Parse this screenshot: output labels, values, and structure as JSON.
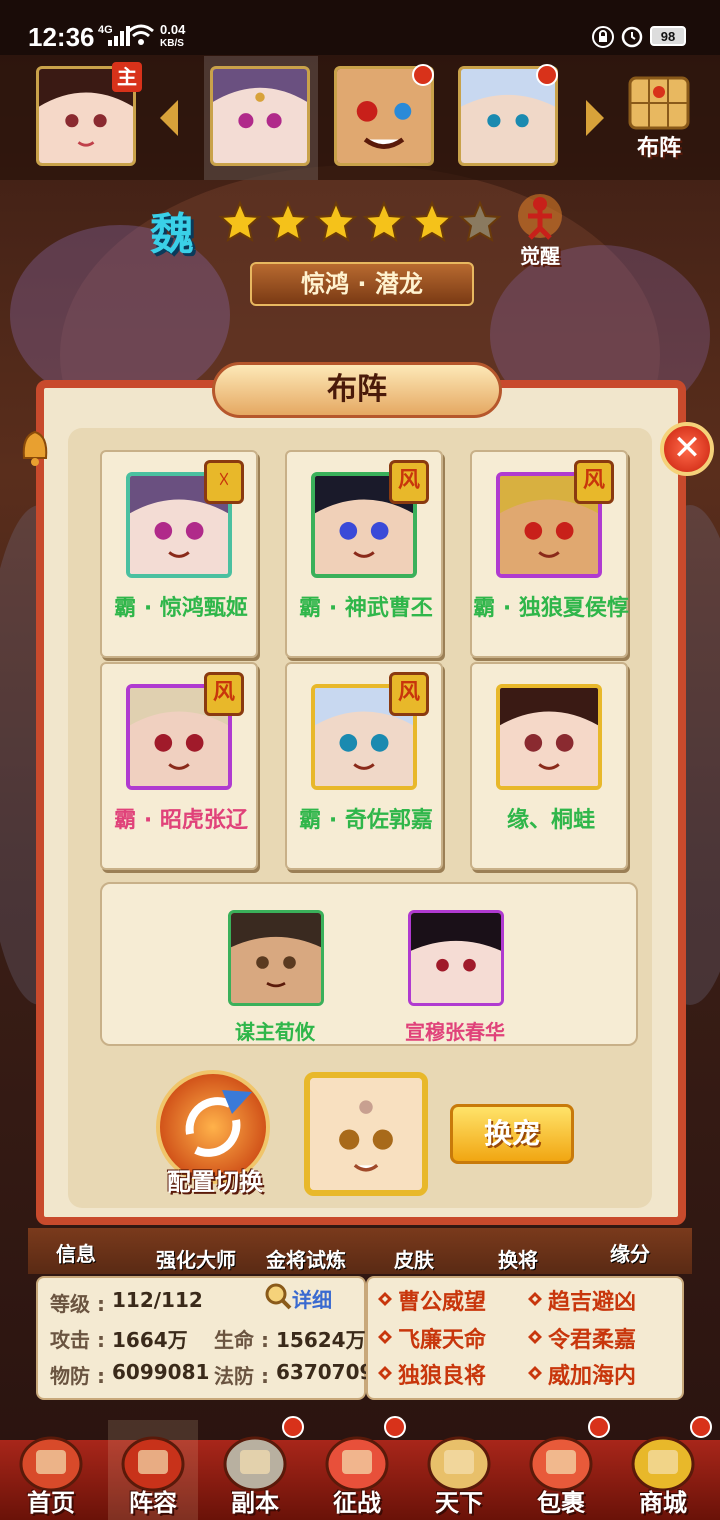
{
  "status_bar": {
    "time": "12:36",
    "network": "4G",
    "speed_value": "0.04",
    "speed_unit": "KB/S",
    "battery": "98"
  },
  "top_bar": {
    "leader_badge": "主",
    "formation_button": "布阵"
  },
  "hero_header": {
    "kingdom": "魏",
    "stars_filled": 5,
    "stars_total": 6,
    "awaken_label": "觉醒",
    "title": "惊鸿 · 潜龙"
  },
  "panel": {
    "title": "布阵",
    "close_icon": "✕",
    "heroes": [
      {
        "name": "霸 · 惊鸿甄姬",
        "badge": "☓",
        "badge_icon": "cross-icon",
        "name_color": "green"
      },
      {
        "name": "霸 · 神武曹丕",
        "badge": "风",
        "badge_icon": "wind-icon",
        "name_color": "green"
      },
      {
        "name": "霸 · 独狼夏侯惇",
        "badge": "风",
        "badge_icon": "wind-icon",
        "name_color": "green"
      },
      {
        "name": "霸 · 昭虎张辽",
        "badge": "风",
        "badge_icon": "wind-icon",
        "name_color": "pink"
      },
      {
        "name": "霸 · 奇佐郭嘉",
        "badge": "风",
        "badge_icon": "wind-icon",
        "name_color": "green"
      },
      {
        "name": "缘、桐蛙",
        "badge": "",
        "badge_icon": "",
        "name_color": "green"
      }
    ],
    "substitutes": [
      {
        "name": "谋主荀攸",
        "name_color": "green"
      },
      {
        "name": "宣穆张春华",
        "name_color": "pink"
      }
    ],
    "config_switch_label": "配置切换",
    "swap_pet_label": "换宠"
  },
  "tabs": [
    "信息",
    "强化大师",
    "金将试炼",
    "皮肤",
    "换将",
    "缘分"
  ],
  "stats": {
    "level_label": "等级 :",
    "level_value": "112/112",
    "detail_label": "详细",
    "attack_label": "攻击 :",
    "attack_value": "1664万",
    "hp_label": "生命 :",
    "hp_value": "15624万",
    "pdef_label": "物防 :",
    "pdef_value": "6099081",
    "mdef_label": "法防 :",
    "mdef_value": "6370709"
  },
  "fates": [
    "曹公威望",
    "趋吉避凶",
    "飞廉天命",
    "令君柔嘉",
    "独狼良将",
    "威加海内"
  ],
  "bottom_nav": [
    "首页",
    "阵容",
    "副本",
    "征战",
    "天下",
    "包裹",
    "商城"
  ],
  "colors": {
    "panel_border": "#c84a2c",
    "name_green": "#2fb64a",
    "name_pink": "#e0427a",
    "fate_red": "#c8360c",
    "gold": "#e8b82a"
  }
}
